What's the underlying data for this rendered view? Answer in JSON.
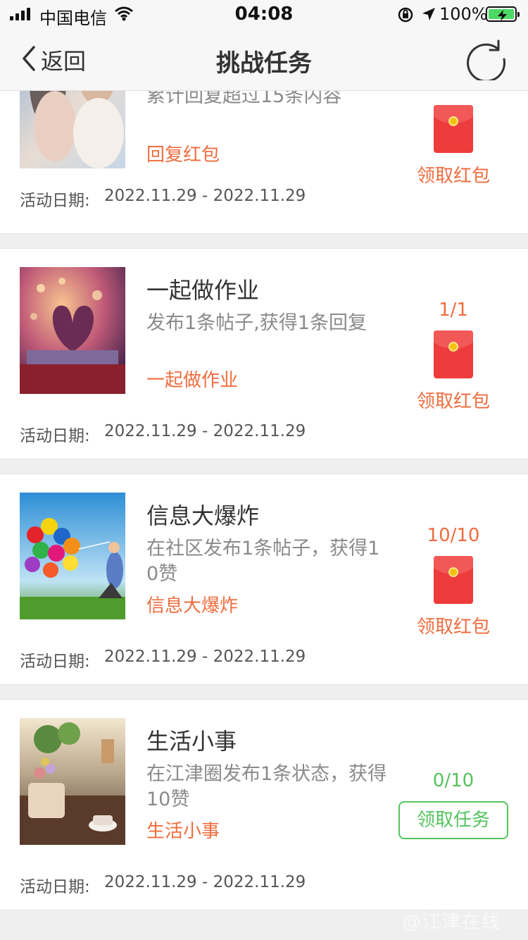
{
  "status_bar": {
    "carrier": "中国电信",
    "time": "04:08",
    "battery_percent": "100%",
    "battery_level": 1.0,
    "icons": [
      "signal-icon",
      "wifi-icon",
      "rotation-lock-icon",
      "location-icon",
      "battery-charging-icon"
    ]
  },
  "nav": {
    "back_label": "返回",
    "title": "挑战任务",
    "back_icon": "chevron-left-icon",
    "refresh_icon": "refresh-icon"
  },
  "date_label": "活动日期:",
  "tasks": [
    {
      "title": "",
      "desc": "累计回复超过15条内容",
      "tag": "回复红包",
      "date_range": "2022.11.29 - 2022.11.29",
      "progress": "",
      "action_label": "领取红包",
      "action_type": "red-packet"
    },
    {
      "title": "一起做作业",
      "desc": "发布1条帖子,获得1条回复",
      "tag": "一起做作业",
      "date_range": "2022.11.29 - 2022.11.29",
      "progress": "1/1",
      "action_label": "领取红包",
      "action_type": "red-packet"
    },
    {
      "title": "信息大爆炸",
      "desc": "在社区发布1条帖子，获得10赞",
      "tag": "信息大爆炸",
      "date_range": "2022.11.29 - 2022.11.29",
      "progress": "10/10",
      "action_label": "领取红包",
      "action_type": "red-packet"
    },
    {
      "title": "生活小事",
      "desc": "在江津圈发布1条状态，获得10赞",
      "tag": "生活小事",
      "date_range": "2022.11.29 - 2022.11.29",
      "progress": "0/10",
      "action_label": "领取任务",
      "action_type": "claim-task"
    }
  ],
  "watermark": "@江津在线",
  "colors": {
    "accent_orange": "#f06d3f",
    "accent_green": "#55c35e",
    "packet_red": "#ee3b3b"
  }
}
